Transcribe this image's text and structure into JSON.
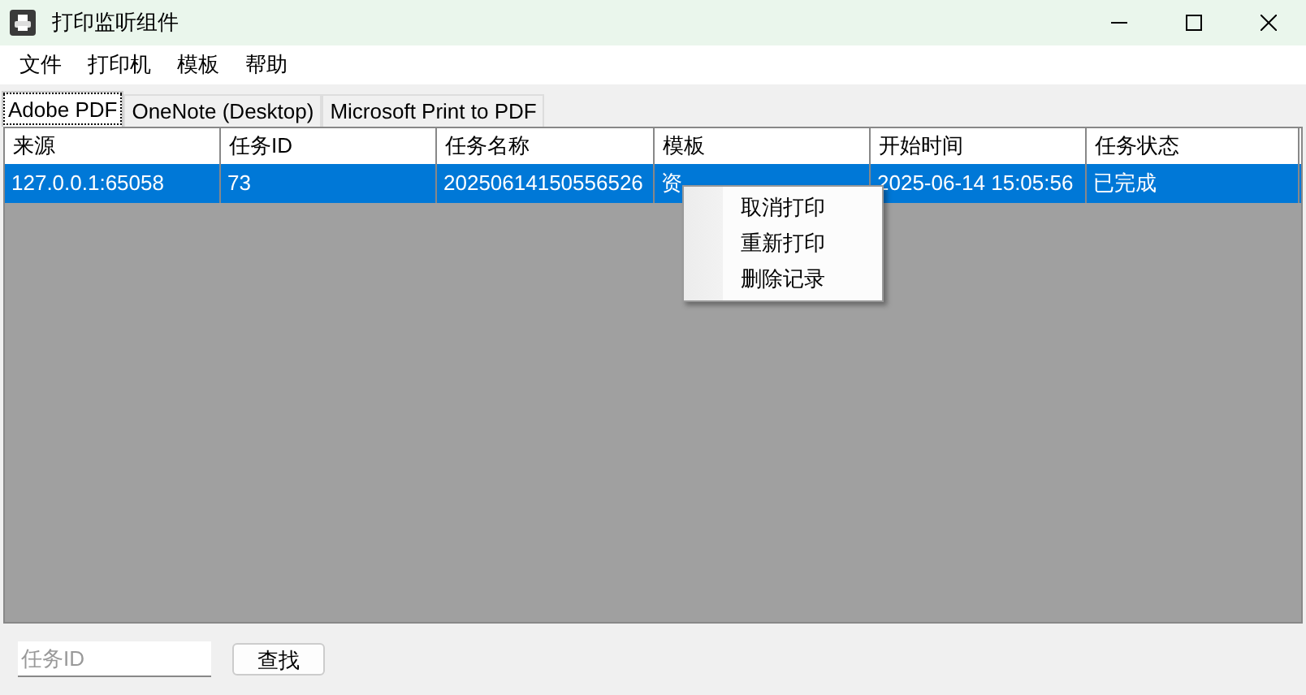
{
  "window": {
    "title": "打印监听组件"
  },
  "menu": [
    "文件",
    "打印机",
    "模板",
    "帮助"
  ],
  "tabs": [
    {
      "label": "Adobe PDF",
      "selected": true
    },
    {
      "label": "OneNote (Desktop)",
      "selected": false
    },
    {
      "label": "Microsoft Print to PDF",
      "selected": false
    }
  ],
  "table": {
    "columns": [
      "来源",
      "任务ID",
      "任务名称",
      "模板",
      "开始时间",
      "任务状态"
    ],
    "rows": [
      {
        "selected": true,
        "cells": [
          "127.0.0.1:65058",
          "73",
          "20250614150556526",
          "资",
          "2025-06-14 15:05:56",
          "已完成"
        ]
      }
    ]
  },
  "context_menu": [
    "取消打印",
    "重新打印",
    "删除记录"
  ],
  "search": {
    "placeholder": "任务ID",
    "button": "查找"
  }
}
